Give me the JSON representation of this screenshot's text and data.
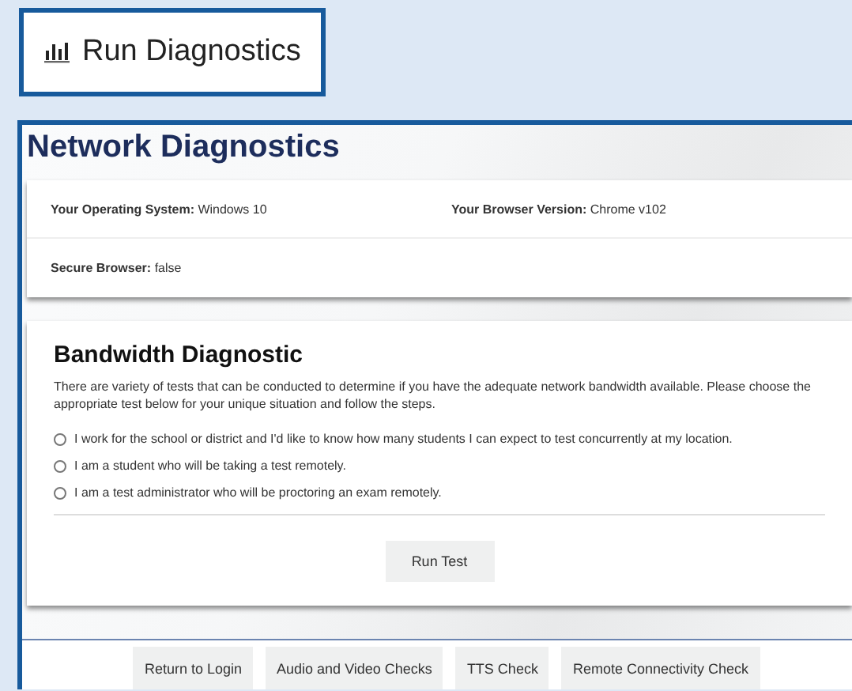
{
  "header_button": {
    "label": "Run Diagnostics"
  },
  "title": "Network Diagnostics",
  "system_info": [
    {
      "text": "**Your Operating System:** Windows 10"
    },
    {
      "text": "**Your Browser Version:** Chrome v102"
    },
    {
      "text": "**Secure Browser:** false"
    }
  ],
  "bandwidth": {
    "heading": "Bandwidth Diagnostic",
    "description": "There are variety of tests that can be conducted to determine if you have the adequate network bandwidth available. Please choose the appropriate test below for your unique situation and follow the steps.",
    "options": [
      {
        "label": "I work for the school or district and I'd like to know how many students I can expect to test concurrently at my location.",
        "selected": false
      },
      {
        "label": "I am a student who will be taking a test remotely.",
        "selected": false
      },
      {
        "label": "I am a test administrator who will be proctoring an exam remotely.",
        "selected": false
      }
    ],
    "button": "Run Test"
  },
  "footer_buttons": [
    "Return to Login",
    "Audio and Video Checks",
    "TTS Check",
    "Remote Connectivity Check"
  ]
}
